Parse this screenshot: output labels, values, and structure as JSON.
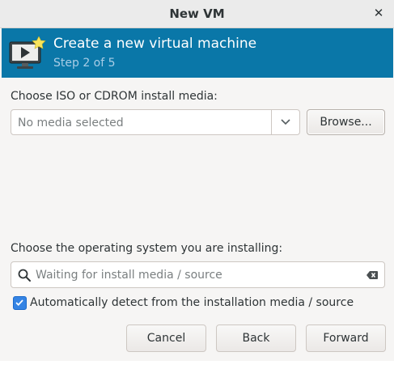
{
  "window": {
    "title": "New VM",
    "close_glyph": "✕"
  },
  "banner": {
    "icon": "vm-monitor-icon",
    "title": "Create a new virtual machine",
    "step": "Step 2 of 5",
    "color": "#0a77a8"
  },
  "install_media": {
    "label": "Choose ISO or CDROM install media:",
    "selected": "No media selected",
    "browse_label": "Browse..."
  },
  "os": {
    "label": "Choose the operating system you are installing:",
    "search_placeholder": "Waiting for install media / source",
    "search_value": ""
  },
  "autodetect": {
    "checked": true,
    "label": "Automatically detect from the installation media / source"
  },
  "footer": {
    "cancel_label": "Cancel",
    "back_label": "Back",
    "forward_label": "Forward"
  },
  "colors": {
    "accent": "#3584e4",
    "banner": "#0a77a8"
  }
}
